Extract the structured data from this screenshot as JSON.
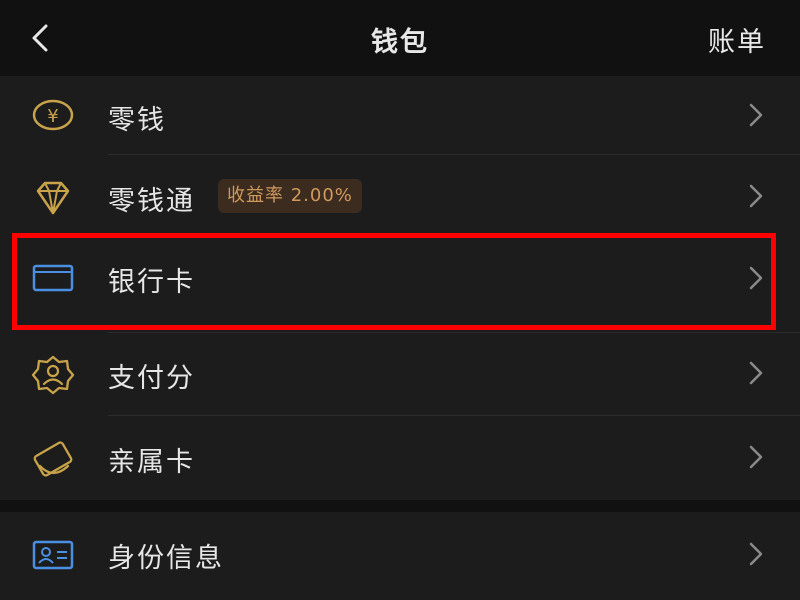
{
  "header": {
    "title": "钱包",
    "right_action": "账单",
    "back_icon": "chevron-left-icon"
  },
  "menu": [
    {
      "label": "零钱",
      "icon": "yuan-coin-icon",
      "icon_color": "#c9a34a"
    },
    {
      "label": "零钱通",
      "icon": "diamond-icon",
      "icon_color": "#c9a34a",
      "badge": "收益率 2.00%"
    },
    {
      "label": "银行卡",
      "icon": "bank-card-icon",
      "icon_color": "#4a90e2"
    },
    {
      "label": "支付分",
      "icon": "score-badge-icon",
      "icon_color": "#c9a34a"
    },
    {
      "label": "亲属卡",
      "icon": "family-card-icon",
      "icon_color": "#c9a34a"
    },
    {
      "label": "身份信息",
      "icon": "id-card-icon",
      "icon_color": "#4a90e2"
    }
  ],
  "colors": {
    "background": "#111111",
    "row_background": "#1c1c1c",
    "text": "#e6e6e6",
    "gold_accent": "#c9a34a",
    "blue_accent": "#4a90e2",
    "badge_text": "#d09a5e",
    "badge_background": "#3b2c1f",
    "highlight": "#ff0000"
  }
}
